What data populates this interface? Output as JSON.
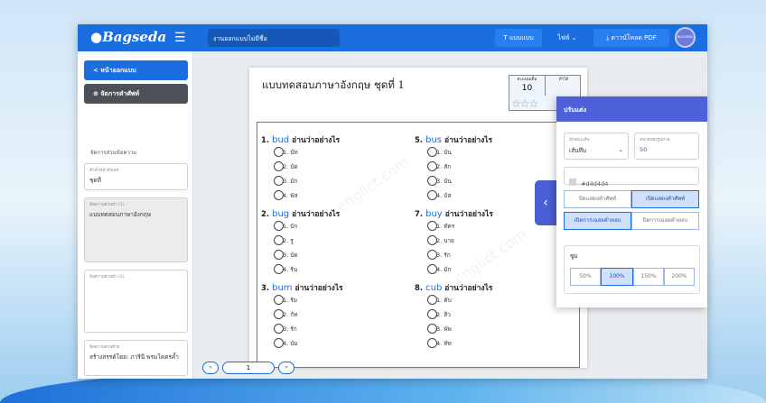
{
  "header": {
    "logo": "Bagseda",
    "doc_name": "งานออกแบบไม่มีชื่อ",
    "font_button": "T แบบแบบ",
    "file_menu": "ไฟล์ ⌄",
    "download_button": "⤓ ดาวน์โหลด PDF",
    "avatar_text": "BAGSEDA"
  },
  "sidebar": {
    "back_label": "<  หน้าออกแบบ",
    "manage_label": "⊕  จัดการคำศัพท์",
    "section_title": "จัดการส่วนข้อความ",
    "fields": [
      {
        "label": "คำนำหน้าตัวเลข",
        "value": "ชุดที่"
      },
      {
        "label": "ข้อความส่วนหัว (1)",
        "value": "แบบทดสอบภาษาอังกฤษ"
      },
      {
        "label": "ข้อความส่วนหัว (2)",
        "value": ""
      },
      {
        "label": "ข้อความส่วนท้าย",
        "value": "สร้างสรรค์โดย: ภารินี พรมโคตรค้ำ"
      }
    ]
  },
  "paper": {
    "title": "แบบทดสอบภาษาอังกฤษ ชุดที่ 1",
    "score_label": "คะแนนเต็ม",
    "score_value": "10",
    "got_label": "ทำได้",
    "stars": "☆☆☆",
    "prompt": "อ่านว่าอย่างไร",
    "questions_left": [
      {
        "num": "1.",
        "word": "bud",
        "options": [
          "1. บัท",
          "2. บัด",
          "3. มัก",
          "4. พัส"
        ]
      },
      {
        "num": "2.",
        "word": "bug",
        "options": [
          "1. บัก",
          "2. รู",
          "3. บัด",
          "4. รัน"
        ]
      },
      {
        "num": "3.",
        "word": "bum",
        "options": [
          "1. รัม",
          "2. กัท",
          "3. รัก",
          "4. บัม"
        ]
      }
    ],
    "questions_right": [
      {
        "num": "5.",
        "word": "bus",
        "options": [
          "1. บัน",
          "2. สัก",
          "3. บัน",
          "4. บัส"
        ]
      },
      {
        "num": "7.",
        "word": "buy",
        "options": [
          "1. ทัคร",
          "2. บาย",
          "3. รัก",
          "4. มัก"
        ]
      },
      {
        "num": "8.",
        "word": "cub",
        "options": [
          "1. คับ",
          "2. สิว",
          "3. พัพ",
          "4. ทัท"
        ]
      }
    ],
    "watermark": "englict.com"
  },
  "pager": {
    "prev": "«",
    "page": "1",
    "next": "»"
  },
  "panel": {
    "title": "ปรับแต่ง",
    "line_label": "ลักษณะเส้น",
    "line_value": "เส้นทึบ",
    "font_size_label": "ขนาดของรูปภาพ",
    "font_size_value": "50",
    "color_value": "#d4d4d4",
    "hide_vocab": "ปิดแสดงคำศัพท์",
    "show_vocab": "เปิดแสดงคำศัพท์",
    "show_answer": "เปิดการเฉลยคำตอบ",
    "hide_answer": "ปิดการเฉลยคำตอบ",
    "zoom_label": "ซูม",
    "zoom_options": [
      "50%",
      "100%",
      "150%",
      "200%"
    ],
    "zoom_selected": "100%"
  },
  "colors": {
    "primary": "#1b6ee0",
    "panel": "#4d60d8",
    "sidebar_dark": "#4b5157"
  }
}
